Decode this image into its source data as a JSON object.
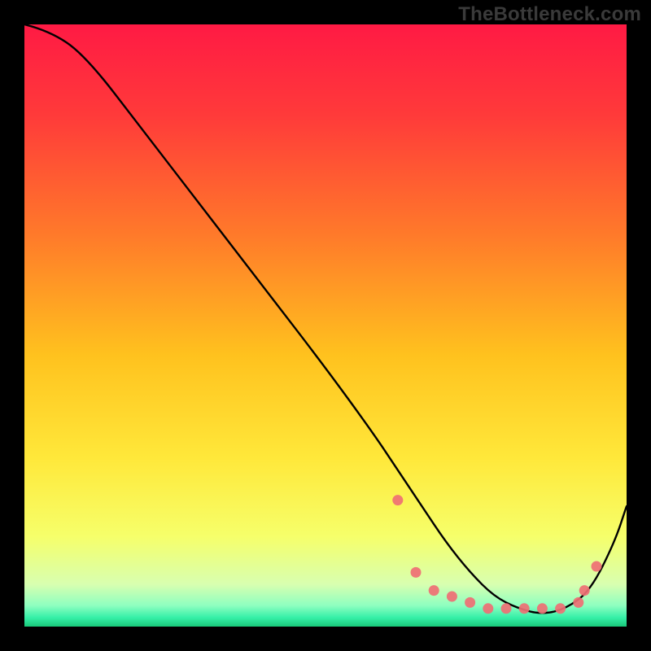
{
  "watermark": "TheBottleneck.com",
  "chart_data": {
    "type": "line",
    "title": "",
    "xlabel": "",
    "ylabel": "",
    "xlim": [
      0,
      100
    ],
    "ylim": [
      0,
      100
    ],
    "grid": false,
    "legend": false,
    "series": [
      {
        "name": "curve",
        "x": [
          0,
          4,
          10,
          20,
          30,
          40,
          50,
          58,
          62,
          66,
          70,
          74,
          78,
          82,
          86,
          90,
          94,
          98,
          100
        ],
        "y": [
          100,
          99,
          95,
          82,
          69,
          56,
          43,
          32,
          26,
          20,
          14,
          9,
          5,
          3,
          2,
          3,
          6,
          14,
          20
        ]
      }
    ],
    "flat_region": {
      "x_start": 62,
      "x_end": 92,
      "y_approx": 3
    },
    "markers": {
      "name": "highlight-dots",
      "x": [
        62,
        65,
        68,
        71,
        74,
        77,
        80,
        83,
        86,
        89,
        92,
        93,
        95
      ],
      "y": [
        21,
        9,
        6,
        5,
        4,
        3,
        3,
        3,
        3,
        3,
        4,
        6,
        10
      ]
    },
    "gradient_stops": [
      {
        "offset": 0.0,
        "color": "#ff1a44"
      },
      {
        "offset": 0.15,
        "color": "#ff3a3a"
      },
      {
        "offset": 0.35,
        "color": "#ff7a2a"
      },
      {
        "offset": 0.55,
        "color": "#ffc21e"
      },
      {
        "offset": 0.72,
        "color": "#ffe83a"
      },
      {
        "offset": 0.85,
        "color": "#f6ff6a"
      },
      {
        "offset": 0.93,
        "color": "#d8ffb0"
      },
      {
        "offset": 0.965,
        "color": "#8effc0"
      },
      {
        "offset": 0.985,
        "color": "#36f0a8"
      },
      {
        "offset": 1.0,
        "color": "#18c87a"
      }
    ]
  }
}
